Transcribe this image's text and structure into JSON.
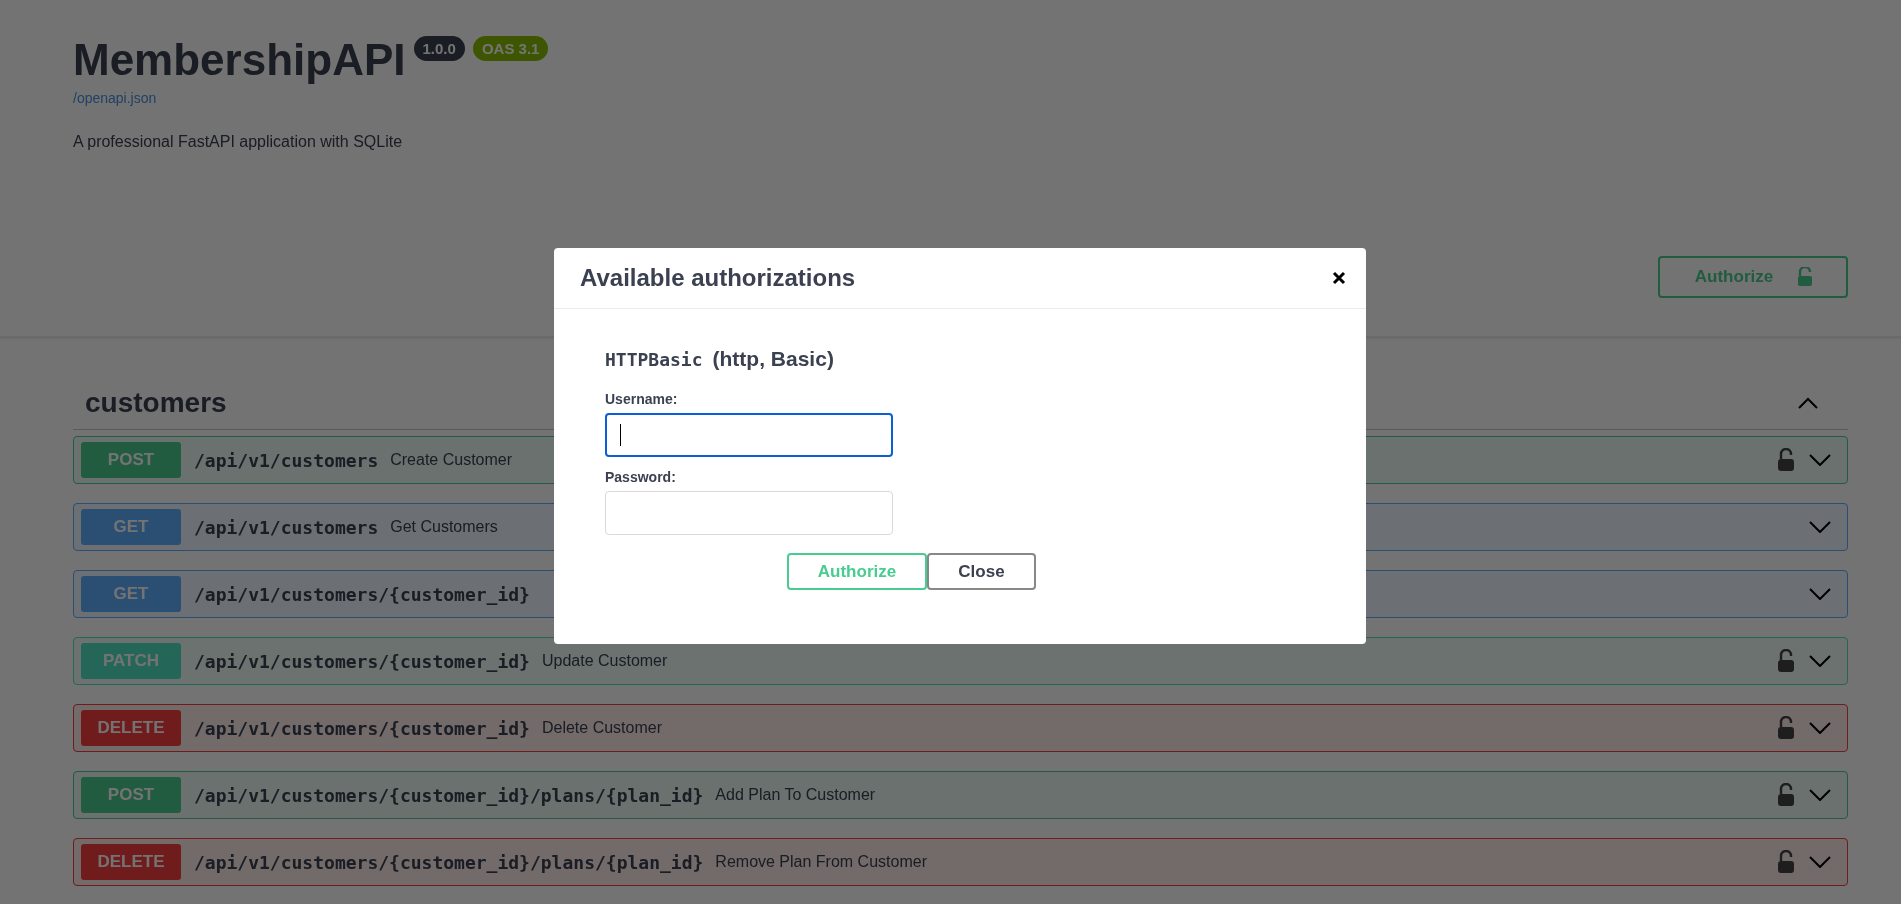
{
  "info": {
    "title": "MembershipAPI",
    "version": "1.0.0",
    "oas": "OAS 3.1",
    "spec_link": "/openapi.json",
    "description": "A professional FastAPI application with SQLite"
  },
  "authorize_button": {
    "label": "Authorize"
  },
  "section": {
    "title": "customers",
    "expanded": true
  },
  "operations": [
    {
      "method": "POST",
      "kind": "post",
      "path": "/api/v1/customers",
      "summary": "Create Customer",
      "locked": true
    },
    {
      "method": "GET",
      "kind": "get",
      "path": "/api/v1/customers",
      "summary": "Get Customers",
      "locked": false
    },
    {
      "method": "GET",
      "kind": "get",
      "path": "/api/v1/customers/{customer_id}",
      "locked": false
    },
    {
      "method": "PATCH",
      "kind": "patch",
      "path": "/api/v1/customers/{customer_id}",
      "summary": "Update Customer",
      "locked": true
    },
    {
      "method": "DELETE",
      "kind": "delete",
      "path": "/api/v1/customers/{customer_id}",
      "summary": "Delete Customer",
      "locked": true
    },
    {
      "method": "POST",
      "kind": "post",
      "path": "/api/v1/customers/{customer_id}/plans/{plan_id}",
      "summary": "Add Plan To Customer",
      "locked": true
    },
    {
      "method": "DELETE",
      "kind": "delete",
      "path": "/api/v1/customers/{customer_id}/plans/{plan_id}",
      "summary": "Remove Plan From Customer",
      "locked": true
    }
  ],
  "modal": {
    "title": "Available authorizations",
    "scheme_name": "HTTPBasic",
    "scheme_type": "(http, Basic)",
    "fields": [
      {
        "label": "Username:",
        "focused": true
      },
      {
        "label": "Password:",
        "focused": false
      }
    ],
    "buttons": [
      {
        "label": "Authorize",
        "kind": "authorize"
      },
      {
        "label": "Close",
        "kind": "close"
      }
    ]
  }
}
